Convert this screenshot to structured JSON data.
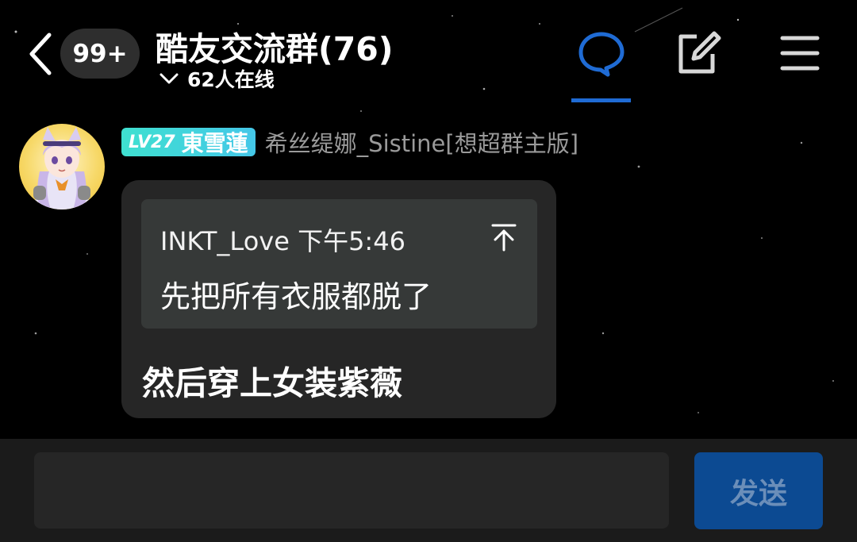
{
  "header": {
    "unread_badge": "99+",
    "group_title": "酷友交流群(76)",
    "online_count": "62人在线"
  },
  "message": {
    "level_badge": "LV27",
    "rank_name": "東雪蓮",
    "sender_name": "希丝缇娜_Sistine[想超群主版]",
    "quote": {
      "author_time": "INKT_Love 下午5:46",
      "text": "先把所有衣服都脱了"
    },
    "text": "然后穿上女装紫薇"
  },
  "composer": {
    "input_value": "",
    "send_label": "发送"
  },
  "colors": {
    "accent": "#1f6bd4",
    "level_badge": "#3fe0d0",
    "send_button": "#0c4a92"
  },
  "icons": [
    "back-icon",
    "chevron-down-icon",
    "chat-bubble-icon",
    "edit-icon",
    "menu-icon",
    "arrow-to-top-icon"
  ]
}
